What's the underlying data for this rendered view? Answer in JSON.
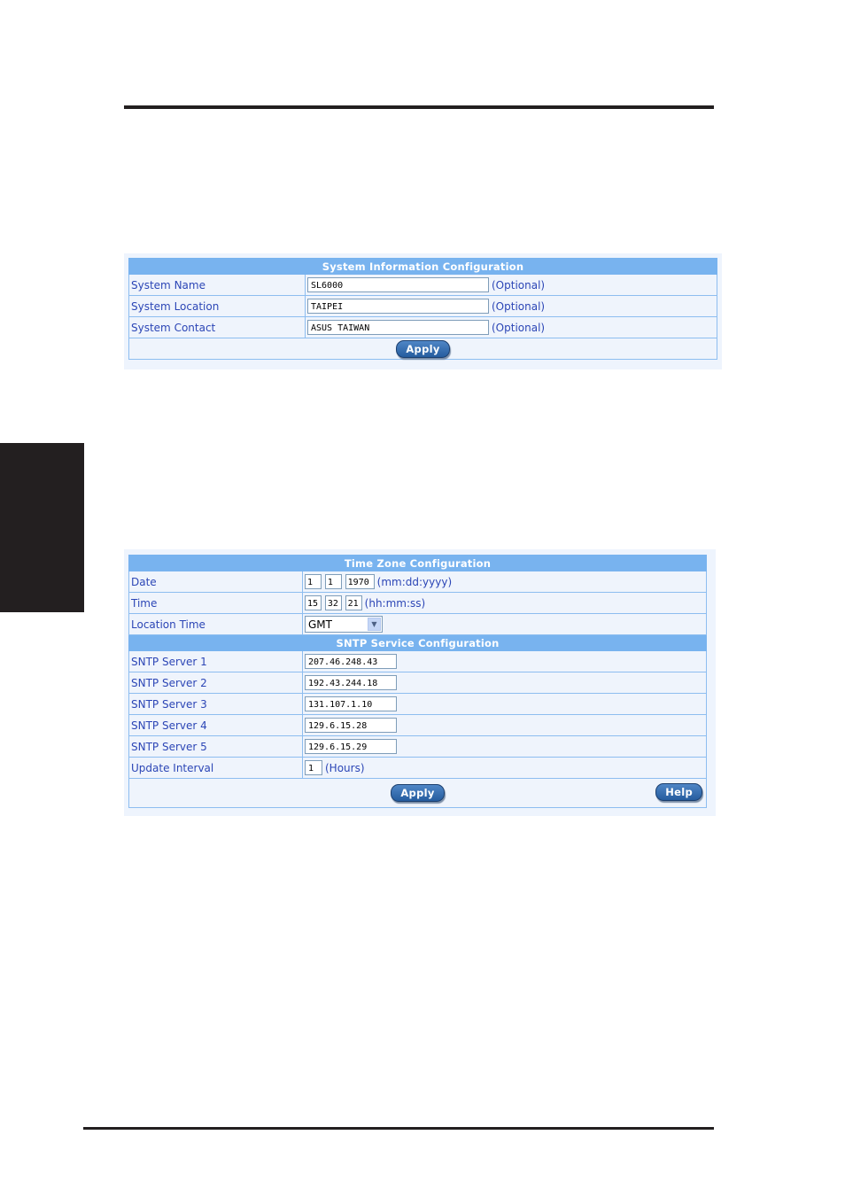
{
  "system_info": {
    "title": "System Information Configuration",
    "rows": [
      {
        "label": "System Name",
        "value": "SL6000",
        "hint": "(Optional)"
      },
      {
        "label": "System Location",
        "value": "TAIPEI",
        "hint": "(Optional)"
      },
      {
        "label": "System Contact",
        "value": "ASUS TAIWAN",
        "hint": "(Optional)"
      }
    ],
    "apply_label": "Apply"
  },
  "time_zone": {
    "title": "Time Zone Configuration",
    "date": {
      "label": "Date",
      "month": "1",
      "day": "1",
      "year": "1970",
      "hint": "(mm:dd:yyyy)"
    },
    "time": {
      "label": "Time",
      "hour": "15",
      "minute": "32",
      "second": "21",
      "hint": "(hh:mm:ss)"
    },
    "location_time": {
      "label": "Location Time",
      "selected": "GMT"
    }
  },
  "sntp": {
    "title": "SNTP Service Configuration",
    "servers": [
      {
        "label": "SNTP Server 1",
        "value": "207.46.248.43"
      },
      {
        "label": "SNTP Server 2",
        "value": "192.43.244.18"
      },
      {
        "label": "SNTP Server 3",
        "value": "131.107.1.10"
      },
      {
        "label": "SNTP Server 4",
        "value": "129.6.15.28"
      },
      {
        "label": "SNTP Server 5",
        "value": "129.6.15.29"
      }
    ],
    "update_interval": {
      "label": "Update Interval",
      "value": "1",
      "hint": "(Hours)"
    },
    "apply_label": "Apply",
    "help_label": "Help"
  }
}
